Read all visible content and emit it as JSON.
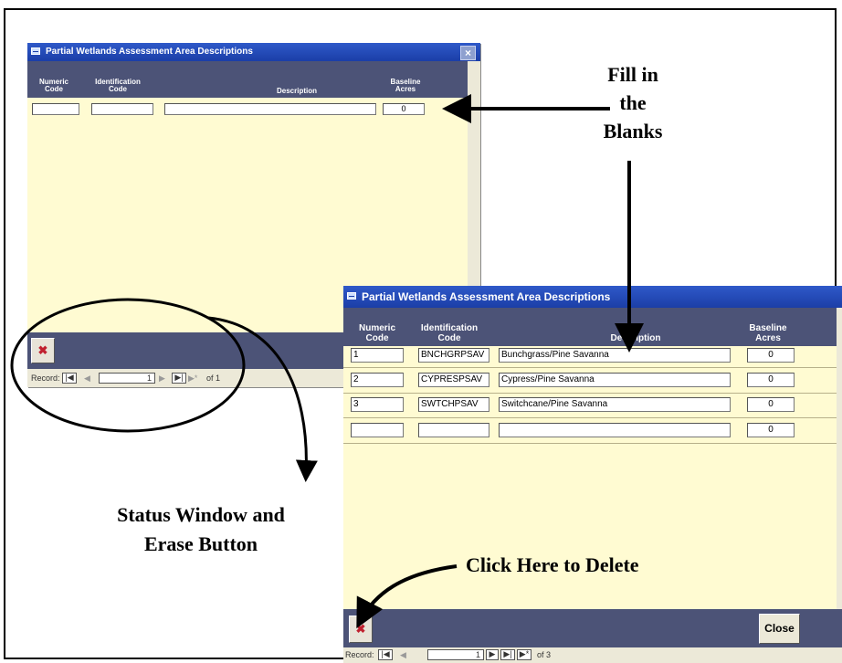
{
  "window": {
    "title": "Partial Wetlands Assessment Area Descriptions",
    "close_glyph": "×"
  },
  "columns": {
    "numeric": "Numeric Code",
    "identification": "Identification Code",
    "description": "Description",
    "baseline": "Baseline Acres"
  },
  "back_form": {
    "baseline_value": "0",
    "record_label": "Record:",
    "record_current": "1",
    "record_total": "of 1"
  },
  "front_form": {
    "rows": [
      {
        "numeric": "1",
        "identification": "BNCHGRPSAV",
        "description": "Bunchgrass/Pine Savanna",
        "baseline": "0"
      },
      {
        "numeric": "2",
        "identification": "CYPRESPSAV",
        "description": "Cypress/Pine Savanna",
        "baseline": "0"
      },
      {
        "numeric": "3",
        "identification": "SWTCHPSAV",
        "description": "Switchcane/Pine Savanna",
        "baseline": "0"
      },
      {
        "numeric": "",
        "identification": "",
        "description": "",
        "baseline": "0"
      }
    ],
    "close_label": "Close",
    "record_label": "Record:",
    "record_current": "1",
    "record_total": "of 3"
  },
  "nav_glyphs": {
    "first": "|◀",
    "prev": "◀",
    "next": "▶",
    "last": "▶|",
    "new": "▶*"
  },
  "delete_glyph": "✖",
  "annotations": {
    "fill_line1": "Fill in",
    "fill_line2": "the",
    "fill_line3": "Blanks",
    "status_line1": "Status Window and",
    "status_line2": "Erase Button",
    "click_delete": "Click Here to Delete"
  }
}
